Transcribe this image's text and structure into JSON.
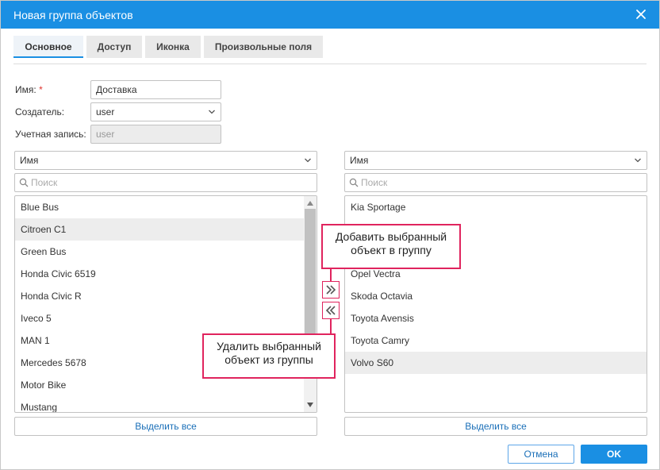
{
  "dialog": {
    "title": "Новая группа объектов",
    "close_icon": "close-icon"
  },
  "tabs": [
    {
      "label": "Основное",
      "active": true
    },
    {
      "label": "Доступ",
      "active": false
    },
    {
      "label": "Иконка",
      "active": false
    },
    {
      "label": "Произвольные поля",
      "active": false
    }
  ],
  "form": {
    "name_label": "Имя:",
    "required_mark": "*",
    "name_value": "Доставка",
    "creator_label": "Создатель:",
    "creator_value": "user",
    "account_label": "Учетная запись:",
    "account_value": "user"
  },
  "left_panel": {
    "sort_value": "Имя",
    "search_placeholder": "Поиск",
    "items": [
      "Blue Bus",
      "Citroen C1",
      "Green Bus",
      "Honda Civic 6519",
      "Honda Civic R",
      "Iveco 5",
      "MAN 1",
      "Mercedes 5678",
      "Motor Bike",
      "Mustang"
    ],
    "selected": "Citroen C1",
    "select_all": "Выделить все"
  },
  "right_panel": {
    "sort_value": "Имя",
    "search_placeholder": "Поиск",
    "items": [
      "Kia Sportage",
      "",
      "",
      "Opel Vectra",
      "Skoda Octavia",
      "Toyota Avensis",
      "Toyota Camry",
      "Volvo S60"
    ],
    "selected": "Volvo S60",
    "select_all": "Выделить все"
  },
  "callouts": {
    "add_line1": "Добавить выбранный",
    "add_line2": "объект в группу",
    "remove_line1": "Удалить выбранный",
    "remove_line2": "объект из группы"
  },
  "footer": {
    "cancel": "Отмена",
    "ok": "OK"
  },
  "colors": {
    "accent": "#1a8fe3",
    "callout": "#e0245e"
  }
}
